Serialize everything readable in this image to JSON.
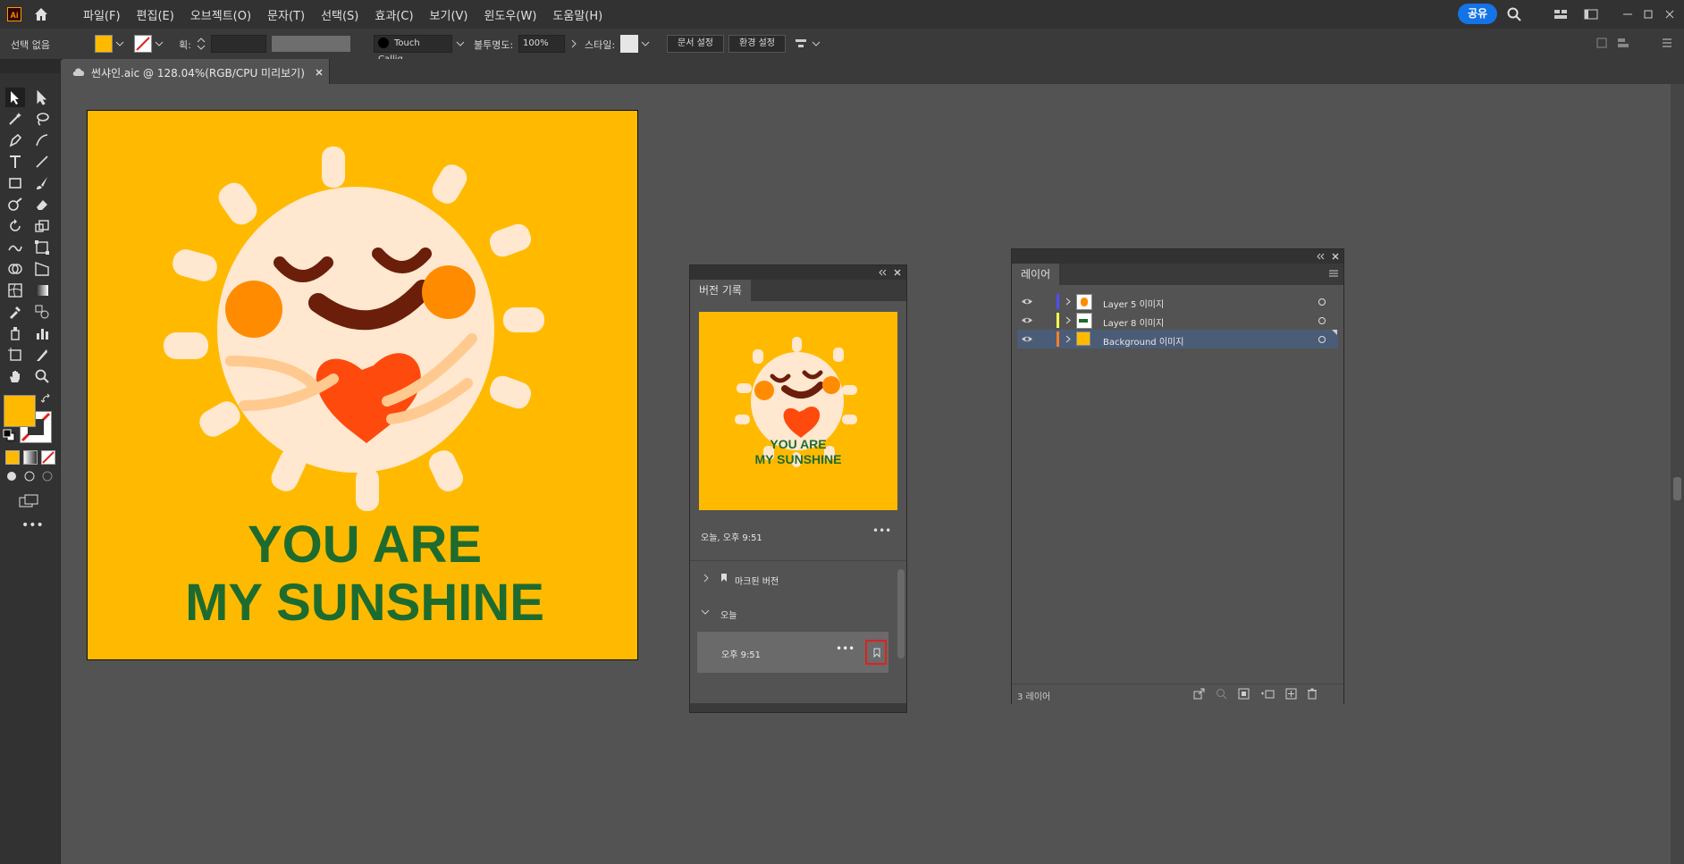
{
  "app": {
    "logo_text": "Ai",
    "title_tab": "썬샤인.aic @ 128.04%(RGB/CPU 미리보기)"
  },
  "menu": [
    "파일(F)",
    "편집(E)",
    "오브젝트(O)",
    "문자(T)",
    "선택(S)",
    "효과(C)",
    "보기(V)",
    "윈도우(W)",
    "도움말(H)"
  ],
  "share_label": "공유",
  "control": {
    "selection": "선택 없음",
    "stroke_label": "획:",
    "brush_name": "Touch Callig...",
    "opacity_label": "불투명도:",
    "opacity_value": "100%",
    "style_label": "스타일:",
    "doc_setup": "문서 설정",
    "preferences": "환경 설정"
  },
  "colors": {
    "fill": "#ffba00",
    "accent": "#1473e6",
    "canvas": "#535353",
    "artboard": "#ffba00",
    "lettering": "#1e6b2f",
    "highlight_border": "#e02020"
  },
  "artwork": {
    "line1": "YOU ARE",
    "line2": "MY SUNSHINE"
  },
  "version_panel": {
    "tab": "버전 기록",
    "timestamp": "오늘, 오후 9:51",
    "thumbnail_line1": "YOU ARE",
    "thumbnail_line2": "MY SUNSHINE",
    "marked": "마크된 버전",
    "today": "오늘",
    "entry_time": "오후 9:51"
  },
  "layers_panel": {
    "tab": "레이어",
    "layers": [
      {
        "name": "Layer 5 이미지",
        "color": "#4d4dff"
      },
      {
        "name": "Layer 8 이미지",
        "color": "#ffff4d"
      },
      {
        "name": "Background 이미지",
        "color": "#ff7f27"
      }
    ],
    "count": "3 레이어"
  }
}
